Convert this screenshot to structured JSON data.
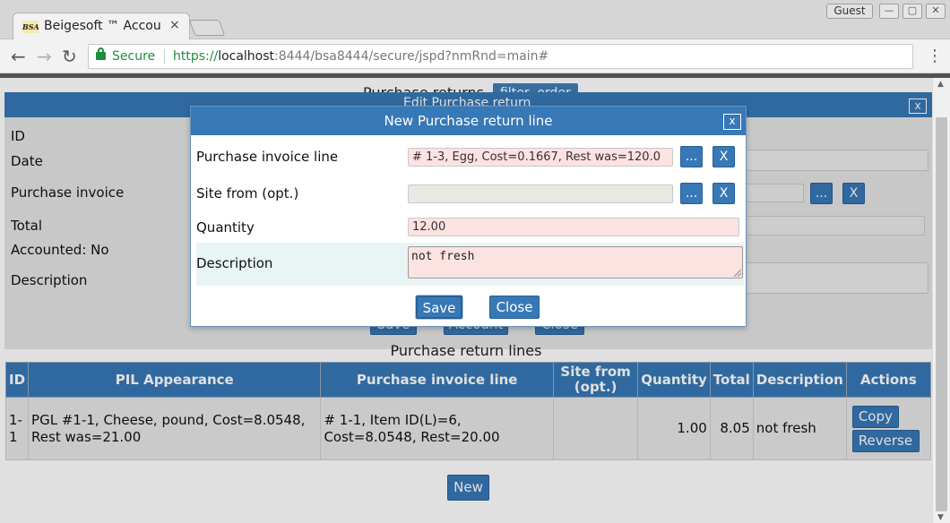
{
  "browser": {
    "tab_title": "Beigesoft ™ Accounting",
    "tab_favicon": "BSA",
    "tab_close": "×",
    "profile": "Guest",
    "secure_label": "Secure",
    "url_protocol": "https://",
    "url_host": "localhost",
    "url_rest": ":8444/bsa8444/secure/jspd?nmRnd=main#"
  },
  "background": {
    "page_title": "Purchase returns",
    "filter_button": "filter, order"
  },
  "edit_dialog": {
    "title": "Edit Purchase return",
    "close": "x",
    "labels": {
      "id": "ID",
      "date": "Date",
      "purchase_invoice": "Purchase invoice",
      "total": "Total",
      "accounted": "Accounted: No",
      "description": "Description"
    },
    "pick_button": "...",
    "clear_button": "X",
    "buttons": {
      "save": "Save",
      "account": "Account",
      "close": "Close"
    }
  },
  "lines": {
    "title": "Purchase return lines",
    "headers": [
      "ID",
      "PIL Appearance",
      "Purchase invoice line",
      "Site from (opt.)",
      "Quantity",
      "Total",
      "Description",
      "Actions"
    ],
    "rows": [
      {
        "id": "1-1",
        "pil_appearance": "PGL #1-1, Cheese, pound, Cost=8.0548, Rest was=21.00",
        "purchase_invoice_line": "# 1-1, Item ID(L)=6, Cost=8.0548, Rest=20.00",
        "site_from": "",
        "quantity": "1.00",
        "total": "8.05",
        "description": "not fresh",
        "actions": {
          "copy": "Copy",
          "reverse": "Reverse"
        }
      }
    ],
    "new_button": "New"
  },
  "modal": {
    "title": "New Purchase return line",
    "close": "x",
    "purchase_invoice_line": {
      "label": "Purchase invoice line",
      "value": "# 1-3, Egg, Cost=0.1667, Rest was=120.0",
      "pick": "...",
      "clear": "X"
    },
    "site_from": {
      "label": "Site from (opt.)",
      "value": "",
      "pick": "...",
      "clear": "X"
    },
    "quantity": {
      "label": "Quantity",
      "value": "12.00"
    },
    "description": {
      "label": "Description",
      "value": "not fresh"
    },
    "save_button": "Save",
    "close_button": "Close"
  },
  "colors": {
    "accent": "#3778b7",
    "required_field": "#fde2e2",
    "secure_green": "#1e8e3e"
  }
}
